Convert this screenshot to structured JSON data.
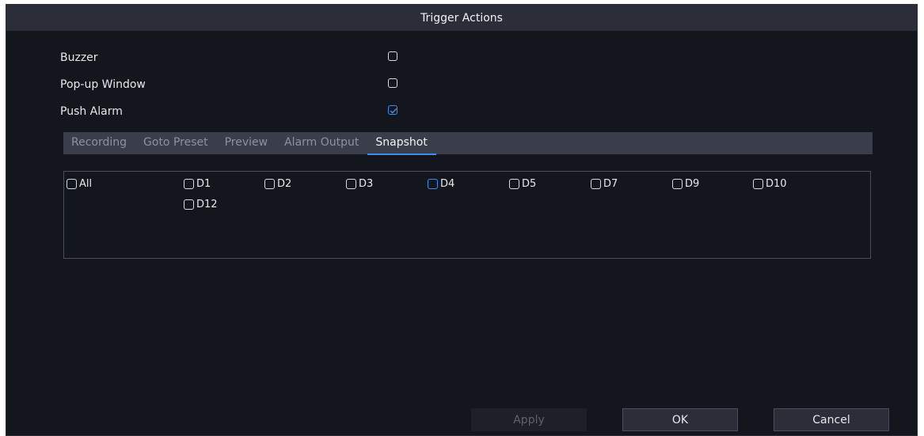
{
  "dialog": {
    "title": "Trigger Actions"
  },
  "options": [
    {
      "label": "Buzzer",
      "checked": false
    },
    {
      "label": "Pop-up Window",
      "checked": false
    },
    {
      "label": "Push Alarm",
      "checked": true
    }
  ],
  "tabs": [
    {
      "label": "Recording",
      "active": false
    },
    {
      "label": "Goto Preset",
      "active": false
    },
    {
      "label": "Preview",
      "active": false
    },
    {
      "label": "Alarm Output",
      "active": false
    },
    {
      "label": "Snapshot",
      "active": true
    }
  ],
  "channels": [
    {
      "label": "All",
      "checked": false
    },
    {
      "label": "D1",
      "checked": false
    },
    {
      "label": "D2",
      "checked": false
    },
    {
      "label": "D3",
      "checked": false
    },
    {
      "label": "D4",
      "checked": false,
      "focused": true
    },
    {
      "label": "D5",
      "checked": false
    },
    {
      "label": "D7",
      "checked": false
    },
    {
      "label": "D9",
      "checked": false
    },
    {
      "label": "D10",
      "checked": false
    },
    {
      "label": "D12",
      "checked": false
    }
  ],
  "buttons": {
    "apply": "Apply",
    "ok": "OK",
    "cancel": "Cancel"
  },
  "colors": {
    "accent": "#3f8df0",
    "background": "#14161d",
    "titlebar": "#2b2e38"
  }
}
